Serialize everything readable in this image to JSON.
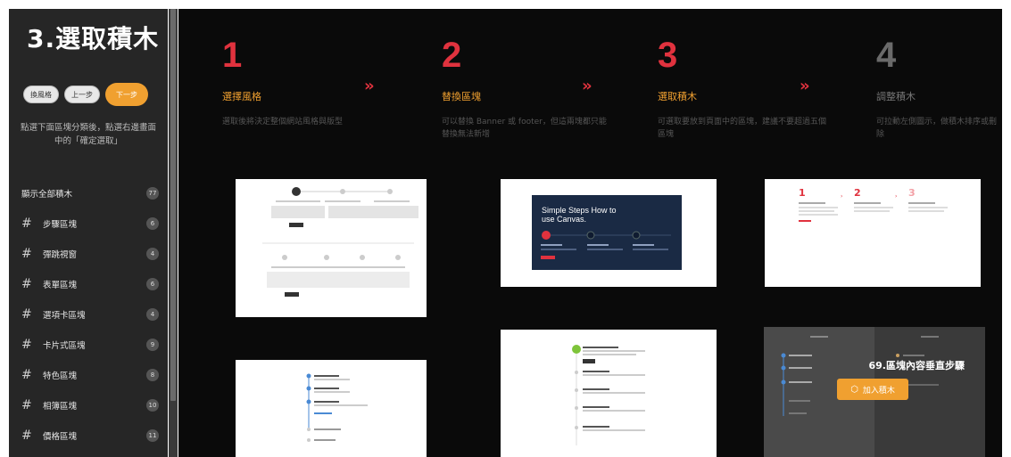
{
  "sidebar": {
    "title": "3.選取積木",
    "buttons": {
      "switch": "換風格",
      "prev": "上一步",
      "next": "下一步"
    },
    "hint": "點選下面區塊分類後，點選右邊畫面中的「確定選取」",
    "show_all": {
      "label": "顯示全部積木",
      "count": "77"
    },
    "items": [
      {
        "label": "步驟區塊",
        "count": "6"
      },
      {
        "label": "彈跳視窗",
        "count": "4"
      },
      {
        "label": "表單區塊",
        "count": "6"
      },
      {
        "label": "選項卡區塊",
        "count": "4"
      },
      {
        "label": "卡片式區塊",
        "count": "9"
      },
      {
        "label": "特色區塊",
        "count": "8"
      },
      {
        "label": "相簿區塊",
        "count": "10"
      },
      {
        "label": "價格區塊",
        "count": "11"
      }
    ]
  },
  "steps": [
    {
      "num": "1",
      "name": "選擇風格",
      "desc": "選取後將決定整個網站風格與版型",
      "color": "#e0323e"
    },
    {
      "num": "2",
      "name": "替換區塊",
      "desc": "可以替換 Banner 或 footer，但這兩塊都只能替換無法新增",
      "color": "#e0323e"
    },
    {
      "num": "3",
      "name": "選取積木",
      "desc": "可選取要放到頁面中的區塊，建議不要超過五個區塊",
      "color": "#e0323e"
    },
    {
      "num": "4",
      "name": "調整積木",
      "desc": "可拉動左側圖示，做積木排序或刪除",
      "color": "#888888"
    }
  ],
  "arrows": [
    "»",
    "»",
    "»"
  ],
  "thumbs": {
    "canvas_title": "Simple Steps How to use Canvas.",
    "mini_steps": [
      "1",
      "2",
      "3"
    ]
  },
  "overlay": {
    "title": "69.區塊內容垂直步驟",
    "add_button": "加入積木"
  },
  "colors": {
    "accent": "#f0a030",
    "red": "#e0323e",
    "navy": "#1a2a44"
  }
}
